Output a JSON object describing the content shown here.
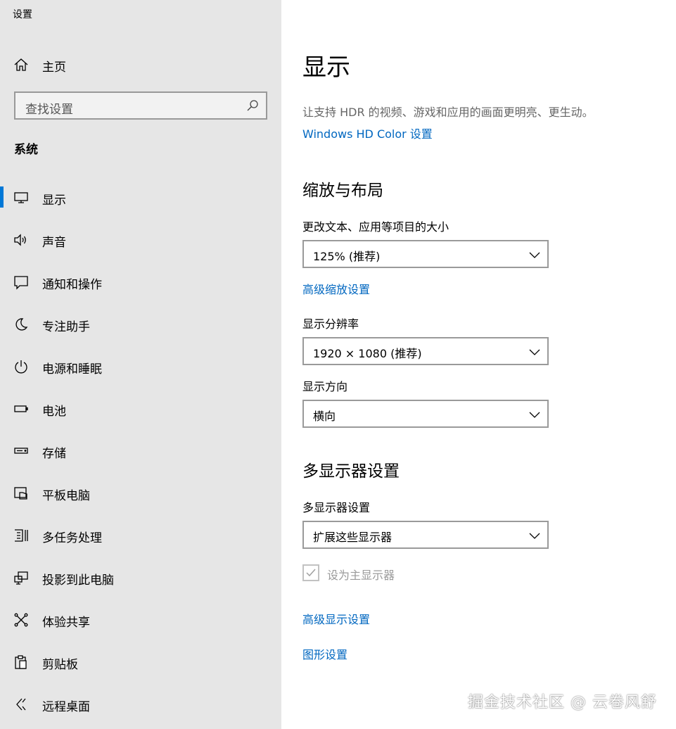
{
  "window": {
    "title": "设置"
  },
  "sidebar": {
    "home_label": "主页",
    "search_placeholder": "查找设置",
    "section_title": "系统",
    "items": [
      {
        "label": "显示",
        "icon": "monitor-icon",
        "active": true
      },
      {
        "label": "声音",
        "icon": "speaker-icon"
      },
      {
        "label": "通知和操作",
        "icon": "notification-icon"
      },
      {
        "label": "专注助手",
        "icon": "moon-icon"
      },
      {
        "label": "电源和睡眠",
        "icon": "power-icon"
      },
      {
        "label": "电池",
        "icon": "battery-icon"
      },
      {
        "label": "存储",
        "icon": "storage-icon"
      },
      {
        "label": "平板电脑",
        "icon": "tablet-icon"
      },
      {
        "label": "多任务处理",
        "icon": "multitasking-icon"
      },
      {
        "label": "投影到此电脑",
        "icon": "project-icon"
      },
      {
        "label": "体验共享",
        "icon": "share-icon"
      },
      {
        "label": "剪贴板",
        "icon": "clipboard-icon"
      },
      {
        "label": "远程桌面",
        "icon": "remote-desktop-icon"
      }
    ]
  },
  "main": {
    "title": "显示",
    "hdr_description": "让支持 HDR 的视频、游戏和应用的画面更明亮、更生动。",
    "hdr_link": "Windows HD Color 设置",
    "scale_section_title": "缩放与布局",
    "scale_label": "更改文本、应用等项目的大小",
    "scale_value": "125% (推荐)",
    "advanced_scale_link": "高级缩放设置",
    "resolution_label": "显示分辨率",
    "resolution_value": "1920 × 1080 (推荐)",
    "orientation_label": "显示方向",
    "orientation_value": "横向",
    "multi_section_title": "多显示器设置",
    "multi_label": "多显示器设置",
    "multi_value": "扩展这些显示器",
    "main_display_checkbox_label": "设为主显示器",
    "main_display_checked": true,
    "advanced_display_link": "高级显示设置",
    "graphics_link": "图形设置"
  },
  "watermark": "掘金技术社区 @ 云卷风舒",
  "colors": {
    "accent": "#0078d7",
    "link": "#0067c0",
    "sidebar_bg": "#e6e6e6"
  }
}
